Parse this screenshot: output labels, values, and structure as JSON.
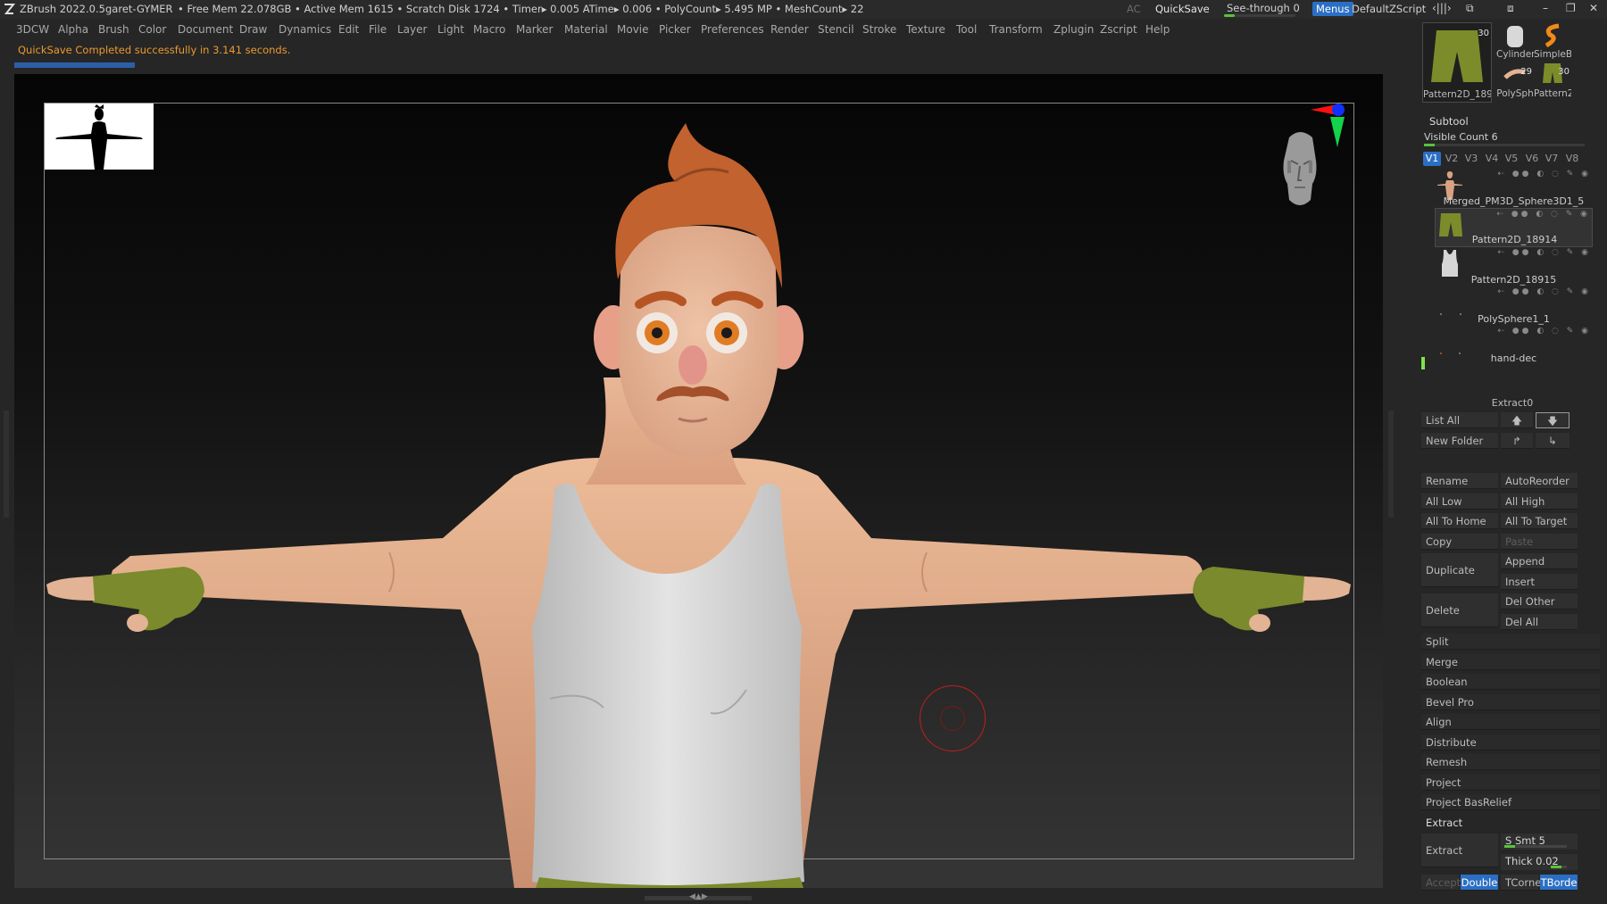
{
  "titlebar": {
    "app": "ZBrush 2022.0.5",
    "project": "garet-GYMER",
    "stats": "• Free Mem 22.078GB • Active Mem 1615 • Scratch Disk 1724 •  Timer▸ 0.005 ATime▸ 0.006 • PolyCount▸ 5.495 MP  • MeshCount▸ 22",
    "ac": "AC",
    "quicksave": "QuickSave",
    "see_through": "See-through  0",
    "see_through_value": 0,
    "menus": "Menus",
    "script": "DefaultZScript",
    "icons": [
      "collapse-icon",
      "layout-icon",
      "layout-alt-icon",
      "minimize-icon",
      "restore-icon",
      "close-icon"
    ]
  },
  "menu": [
    "3DCW",
    "Alpha",
    "Brush",
    "Color",
    "Document",
    "Draw",
    "Dynamics",
    "Edit",
    "File",
    "Layer",
    "Light",
    "Macro",
    "Marker",
    "Material",
    "Movie",
    "Picker",
    "Preferences",
    "Render",
    "Stencil",
    "Stroke",
    "Texture",
    "Tool",
    "Transform",
    "Zplugin",
    "Zscript",
    "Help"
  ],
  "status": {
    "message": "QuickSave Completed successfully in ",
    "seconds": "3.141",
    "unit": " seconds."
  },
  "tools": {
    "main": {
      "name": "Pattern2D_1891-",
      "count": "30"
    },
    "small": [
      {
        "name": "Cylinder"
      },
      {
        "name": "SimpleB"
      },
      {
        "name": "PolySph",
        "count": "29"
      },
      {
        "name": "Pattern2",
        "count": "30"
      }
    ]
  },
  "subtool": {
    "title": "Subtool",
    "visible_count": "Visible Count 6",
    "tabs": [
      "V1",
      "V2",
      "V3",
      "V4",
      "V5",
      "V6",
      "V7",
      "V8"
    ],
    "items": [
      {
        "name": "Merged_PM3D_Sphere3D1_5"
      },
      {
        "name": "Pattern2D_18914"
      },
      {
        "name": "Pattern2D_18915"
      },
      {
        "name": "PolySphere1_1"
      },
      {
        "name": "hand-dec"
      }
    ],
    "extract0": "Extract0",
    "list_all": "List All",
    "new_folder": "New Folder",
    "rename": "Rename",
    "auto_reorder": "AutoReorder",
    "all_low": "All Low",
    "all_high": "All High",
    "all_to_home": "All To Home",
    "all_to_target": "All To Target",
    "copy": "Copy",
    "paste": "Paste",
    "duplicate": "Duplicate",
    "append": "Append",
    "insert": "Insert",
    "delete": "Delete",
    "del_other": "Del Other",
    "del_all": "Del All",
    "sections": [
      "Split",
      "Merge",
      "Boolean",
      "Bevel Pro",
      "Align",
      "Distribute",
      "Remesh",
      "Project",
      "Project BasRelief",
      "Extract"
    ],
    "extract": {
      "button": "Extract",
      "s_smt": "S Smt 5",
      "thick": "Thick 0.02",
      "accept": "Accept",
      "double": "Double",
      "tcorne": "TCorne",
      "tborde": "TBorde"
    }
  },
  "colors": {
    "accent_blue": "#2b6fc4",
    "slider_green": "#58c43c",
    "status_orange": "#ea9a2e",
    "skin": "#e1a887",
    "hair": "#c1622f",
    "shirt": "#d6d6d6",
    "gloves": "#7a8a2c"
  }
}
